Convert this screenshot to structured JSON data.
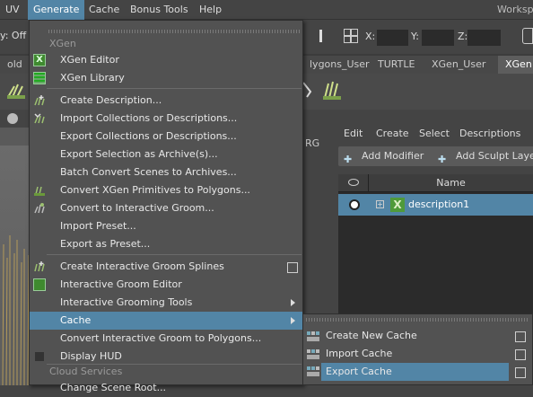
{
  "menubar": {
    "items": [
      "UV",
      "Generate",
      "Cache",
      "Bonus Tools",
      "Help"
    ],
    "workspace_label": "Worksp"
  },
  "status": {
    "symmetry_label": "y: Off",
    "x_label": "X:",
    "y_label": "Y:",
    "z_label": "Z:"
  },
  "shelf": {
    "tabs": [
      "old",
      "lygons_User",
      "TURTLE",
      "XGen_User",
      "XGen"
    ]
  },
  "viewport": {
    "side_label": "RG"
  },
  "xgen_panel": {
    "menus": [
      "Edit",
      "Create",
      "Select",
      "Descriptions"
    ],
    "add_modifier": "Add Modifier",
    "add_sculpt_layer": "Add Sculpt Layer",
    "column_name": "Name",
    "description_row": "description1"
  },
  "generate_menu": {
    "section_xgen": "XGen",
    "section_cloud": "Cloud Services",
    "items": [
      {
        "label": "XGen Editor",
        "icon": "xgen-editor-icon"
      },
      {
        "label": "XGen Library",
        "icon": "xgen-library-icon"
      },
      {
        "label": "Create Description...",
        "icon": "none"
      },
      {
        "label": "Import Collections or Descriptions...",
        "icon": "import-collection-icon"
      },
      {
        "label": "Export Collections or Descriptions...",
        "icon": "none"
      },
      {
        "label": "Export Selection as Archive(s)...",
        "icon": "none"
      },
      {
        "label": "Batch Convert Scenes to Archives...",
        "icon": "none"
      },
      {
        "label": "Convert XGen Primitives to Polygons...",
        "icon": "convert-primitives-icon"
      },
      {
        "label": "Convert to Interactive Groom...",
        "icon": "convert-groom-icon"
      },
      {
        "label": "Import Preset...",
        "icon": "none"
      },
      {
        "label": "Export as Preset...",
        "icon": "none"
      },
      {
        "label": "Create Interactive Groom Splines",
        "icon": "groom-splines-icon"
      },
      {
        "label": "Interactive Groom Editor",
        "icon": "groom-editor-icon"
      },
      {
        "label": "Interactive Grooming Tools",
        "icon": "none"
      },
      {
        "label": "Cache",
        "icon": "none"
      },
      {
        "label": "Convert Interactive Groom to Polygons...",
        "icon": "none"
      },
      {
        "label": "Display HUD",
        "icon": "none"
      },
      {
        "label": "Change Scene Root...",
        "icon": "none"
      }
    ]
  },
  "cache_submenu": {
    "items": [
      "Create New Cache",
      "Import Cache",
      "Export Cache"
    ]
  },
  "colors": {
    "highlight": "#5285a6",
    "menu_bg": "#525252",
    "app_bg": "#444444"
  }
}
